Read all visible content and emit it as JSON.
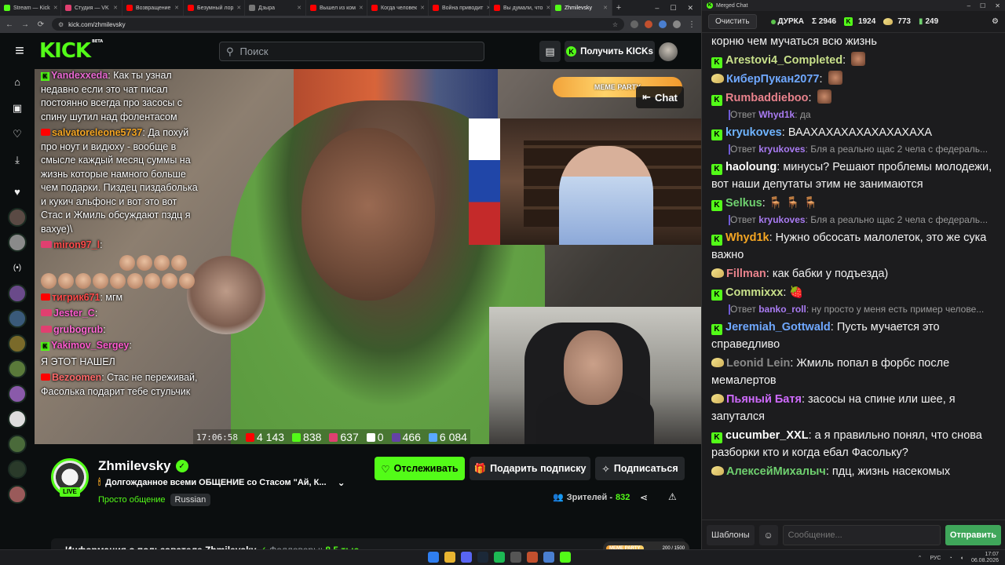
{
  "browser": {
    "tabs": [
      {
        "label": "Stream — Kick",
        "color": "#53fc18"
      },
      {
        "label": "Студия — VK",
        "color": "#e03f70"
      },
      {
        "label": "Возвращение",
        "color": "#ff0000"
      },
      {
        "label": "Безумный лор",
        "color": "#ff0000"
      },
      {
        "label": "Дзыра",
        "color": "#777777"
      },
      {
        "label": "Вышел из ком",
        "color": "#ff0000"
      },
      {
        "label": "Когда человек",
        "color": "#ff0000"
      },
      {
        "label": "Война приводит",
        "color": "#ff0000"
      },
      {
        "label": "Вы думали, что",
        "color": "#ff0000"
      },
      {
        "label": "Zhmilevsky",
        "color": "#53fc18",
        "active": true
      }
    ],
    "url": "kick.com/zhmilevsky"
  },
  "kick_header": {
    "logo": "KICK",
    "logo_badge": "BETA",
    "search_placeholder": "Поиск",
    "get_kicks_label": "Получить KICKs"
  },
  "sidebar_icons": [
    "home-icon",
    "browse-icon",
    "following-icon",
    "download-icon",
    "heart-icon"
  ],
  "overlay_chat": [
    {
      "user": "Yandexxeda",
      "text": "Как ты узнал недавно если это чат писал постоянно всегда про засосы с спину шутил над фолентасом",
      "platform": "kick",
      "color": "#e96ad2"
    },
    {
      "user": "salvatoreleone5737",
      "text": "Да похуй про ноут и видюху - вообще в смысле каждый месяц суммы на жизнь которые намного больше чем подарки. Пиздец пиздаболька и кукич альфонс и вот это вот Стас и Жмиль обсуждают пздц я вахуе)\\",
      "platform": "youtube",
      "color": "#f5a623"
    },
    {
      "user": "miron97_l",
      "text": "",
      "platform": "vk",
      "color": "#ff4b4b"
    },
    {
      "user": "тигрик671",
      "text": "мгм",
      "platform": "youtube",
      "color": "#ff4b4b"
    },
    {
      "user": "Jester_C",
      "text": "",
      "platform": "vk",
      "color": "#ff5ccf"
    },
    {
      "user": "grubogrub",
      "text": "",
      "platform": "vk",
      "color": "#ff6ad5"
    },
    {
      "user": "Yakimov_Sergey",
      "text": "",
      "platform": "kick",
      "color": "#ff5ccf"
    },
    {
      "user": "",
      "text": "Я ЭТОТ НАШЕЛ",
      "platform": "",
      "color": "#ffffff"
    },
    {
      "user": "Bezoomen",
      "text": "Стас не переживай, Фасолька подарит тебе стульчик",
      "platform": "youtube",
      "color": "#ff6a6a"
    }
  ],
  "video_overlay": {
    "meme_party": "MEME PARTY",
    "chat_button": "Chat",
    "time": "17:06:58",
    "stats": [
      {
        "icon": "youtube-icon",
        "value": "4 143",
        "color": "#ff0000"
      },
      {
        "icon": "kick-icon",
        "value": "838",
        "color": "#53fc18"
      },
      {
        "icon": "vk-live-icon",
        "value": "637",
        "color": "#e03f70"
      },
      {
        "icon": "rutube-icon",
        "value": "0",
        "color": "#ffffff"
      },
      {
        "icon": "twitch-icon",
        "value": "466",
        "color": "#6441a5"
      },
      {
        "icon": "viewers-icon",
        "value": "6 084",
        "color": "#5aa9ff"
      }
    ]
  },
  "channel": {
    "name": "Zhmilevsky",
    "live_badge": "LIVE",
    "title": "Долгожданное всеми ОБЩЕНИЕ со Стасом \"Ай, К...",
    "category": "Просто общение",
    "language": "Russian",
    "follow_label": "Отслеживать",
    "gift_label": "Подарить подписку",
    "subscribe_label": "Подписаться",
    "viewers_label": "Зрителей -",
    "viewers_count": "832",
    "about_text": "Информация о пользователе Zhmilevsky",
    "followers_label": "Фолловеры:",
    "followers_value": "8,5 тыс"
  },
  "merged_chat": {
    "window_title": "Merged Chat",
    "clear_label": "Очистить",
    "status_label": "ДУРКА",
    "stat_sum": "Σ 2946",
    "stat_kick": "1924",
    "stat_twitch": "773",
    "stat_other": "249",
    "templates_label": "Шаблоны",
    "input_placeholder": "Сообщение...",
    "send_label": "Отправить",
    "messages": [
      {
        "type": "cont",
        "text": "корню чем мучаться всю жизнь"
      },
      {
        "type": "msg",
        "platform": "kick",
        "user": "Arestovi4_Completed",
        "color": "#c8e08a",
        "text": "",
        "emote": true
      },
      {
        "type": "msg",
        "platform": "twitch",
        "user": "КиберПукан2077",
        "color": "#6fa8ff",
        "text": "",
        "emote": true
      },
      {
        "type": "msg",
        "platform": "kick",
        "user": "Rumbaddieboo",
        "color": "#e8828c",
        "text": "",
        "emote": true
      },
      {
        "type": "reply",
        "prefix": "Ответ",
        "user": "Whyd1k",
        "text": ": да"
      },
      {
        "type": "msg",
        "platform": "kick",
        "user": "kryukoves",
        "color": "#6fb4ff",
        "text": "ВААХАХАХАХАХАХАХАХА"
      },
      {
        "type": "reply",
        "prefix": "Ответ",
        "user": "kryukoves",
        "text": ": Бля а реально щас 2 чела с федераль..."
      },
      {
        "type": "msg",
        "platform": "kick",
        "user": "haoloung",
        "color": "#ffffff",
        "text": "минусы? Решают проблемы молодежи, вот наши депутаты этим не занимаются"
      },
      {
        "type": "msg",
        "platform": "kick",
        "user": "Selkus",
        "color": "#6fd06f",
        "text": "🪑 🪑 🪑"
      },
      {
        "type": "reply",
        "prefix": "Ответ",
        "user": "kryukoves",
        "text": ": Бля а реально щас 2 чела с федераль..."
      },
      {
        "type": "msg",
        "platform": "kick",
        "user": "Whyd1k",
        "color": "#f5a623",
        "text": "Нужно обсосать малолеток, это же сука важно"
      },
      {
        "type": "msg",
        "platform": "twitch",
        "user": "Fillman",
        "color": "#e8828c",
        "text": "как бабки у подъезда)"
      },
      {
        "type": "msg",
        "platform": "kick",
        "user": "Commixxx",
        "color": "#c8e08a",
        "text": "🍓"
      },
      {
        "type": "reply",
        "prefix": "Ответ",
        "user": "banko_roll",
        "text": ": ну просто у меня есть пример челове..."
      },
      {
        "type": "msg",
        "platform": "kick",
        "user": "Jeremiah_Gottwald",
        "color": "#6fa8ff",
        "text": "Пусть мучается это справедливо"
      },
      {
        "type": "msg",
        "platform": "twitch",
        "user": "Leonid Lein",
        "color": "#8a8a8a",
        "text": "Жмиль попал в форбс после мемалертов"
      },
      {
        "type": "msg",
        "platform": "twitch",
        "user": "Пьяный Батя",
        "color": "#d06bff",
        "text": "засосы на спине или шее, я запутался"
      },
      {
        "type": "msg",
        "platform": "kick",
        "user": "cucumber_XXL",
        "color": "#ffffff",
        "text": "а я правильно понял, что снова разборки кто и когда ебал Фасольку?"
      },
      {
        "type": "msg",
        "platform": "twitch",
        "user": "АлексейМихалыч",
        "color": "#6fd06f",
        "text": "пдц, жизнь насекомых"
      }
    ]
  },
  "taskbar": {
    "lang": "РУС",
    "time": "17:07",
    "date": "06.08.2026",
    "mini_party": "MEME PARTY",
    "mini_progress": "200 / 1500"
  }
}
